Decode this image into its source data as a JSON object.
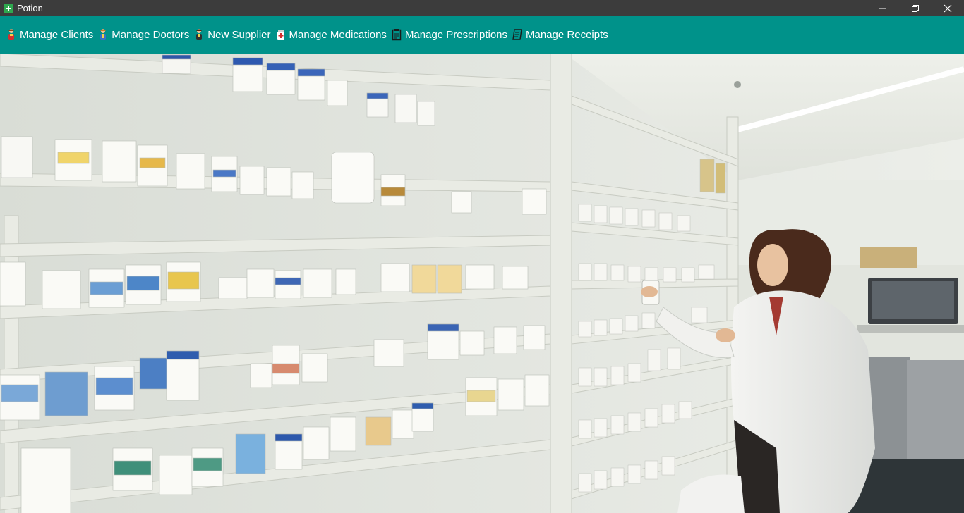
{
  "window": {
    "title": "Potion",
    "controls": [
      "minimize-icon",
      "restore-icon",
      "close-icon"
    ]
  },
  "menu": {
    "items": [
      {
        "label": "Manage Clients",
        "icon": "client-person-icon"
      },
      {
        "label": "Manage Doctors",
        "icon": "doctor-person-icon"
      },
      {
        "label": "New Supplier",
        "icon": "supplier-person-icon"
      },
      {
        "label": "Manage Medications",
        "icon": "medicine-bottle-icon"
      },
      {
        "label": "Manage Prescriptions",
        "icon": "prescription-clipboard-icon"
      },
      {
        "label": "Manage Receipts",
        "icon": "receipt-icon"
      }
    ]
  },
  "colors": {
    "titlebar": "#3c3c3c",
    "menubar": "#00928a",
    "app_icon": "#2fa84f"
  },
  "hero_image": {
    "icon": "pharmacy-shelves-photo"
  }
}
